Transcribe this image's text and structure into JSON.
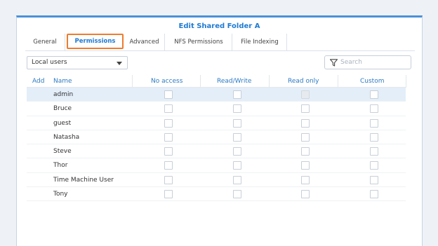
{
  "dialog": {
    "title": "Edit Shared Folder A"
  },
  "tabs": [
    {
      "label": "General",
      "active": false
    },
    {
      "label": "Permissions",
      "active": true
    },
    {
      "label": "Advanced",
      "active": false
    },
    {
      "label": "NFS Permissions",
      "active": false
    },
    {
      "label": "File Indexing",
      "active": false
    }
  ],
  "user_type_select": {
    "value": "Local users"
  },
  "search": {
    "placeholder": "Search",
    "icon": "filter-icon"
  },
  "table": {
    "columns": {
      "add": "Add",
      "name": "Name",
      "no_access": "No access",
      "read_write": "Read/Write",
      "read_only": "Read only",
      "custom": "Custom"
    },
    "rows": [
      {
        "name": "admin",
        "selected": true,
        "read_only_disabled": true
      },
      {
        "name": "Bruce"
      },
      {
        "name": "guest"
      },
      {
        "name": "Natasha"
      },
      {
        "name": "Steve"
      },
      {
        "name": "Thor"
      },
      {
        "name": "Time Machine User"
      },
      {
        "name": "Tony"
      }
    ]
  },
  "colors": {
    "accent": "#1f7ad3",
    "active_tab_border": "#ee7c2e",
    "selected_row": "#e3eef9"
  }
}
